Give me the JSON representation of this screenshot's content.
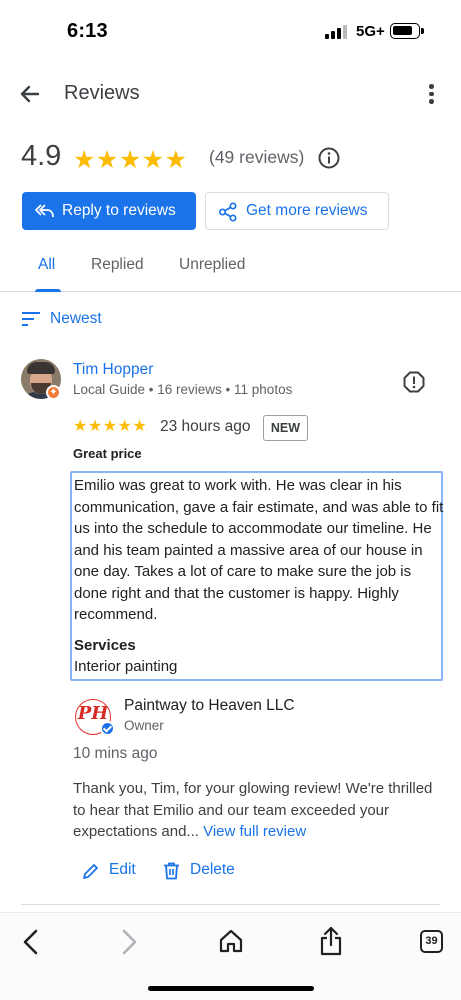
{
  "status_bar": {
    "time": "6:13",
    "network": "5G+"
  },
  "app_bar": {
    "title": "Reviews"
  },
  "summary": {
    "rating": "4.9",
    "stars": "★★★★★",
    "count_text": "(49 reviews)"
  },
  "actions": {
    "reply_label": "Reply to reviews",
    "more_label": "Get more reviews"
  },
  "tabs": [
    {
      "label": "All",
      "active": true
    },
    {
      "label": "Replied",
      "active": false
    },
    {
      "label": "Unreplied",
      "active": false
    }
  ],
  "sort": {
    "label": "Newest"
  },
  "review": {
    "author": "Tim Hopper",
    "meta": "Local Guide • 16 reviews • 11 photos",
    "stars": "★★★★★",
    "rating": 5,
    "time": "23 hours ago",
    "badge": "NEW",
    "headline": "Great price",
    "text": "Emilio was great to work with. He was clear in his communication, gave a fair estimate, and was able to fit us into the schedule to accommodate our timeline. He and his team painted a massive area of our house in one day. Takes a lot of care to make sure the job is done right and that the customer is happy. Highly recommend.",
    "services_title": "Services",
    "services_value": "Interior painting"
  },
  "owner_reply": {
    "name": "Paintway to Heaven LLC",
    "role": "Owner",
    "time": "10 mins ago",
    "text": "Thank you, Tim, for your glowing review! We're thrilled to hear that Emilio and our team exceeded your expectations and...",
    "view_full": "View full review",
    "edit_label": "Edit",
    "delete_label": "Delete"
  },
  "browser": {
    "tab_count": "39"
  },
  "colors": {
    "accent": "#1a73e8",
    "star": "#fbbc04",
    "selection_border": "#8ab4f8"
  }
}
